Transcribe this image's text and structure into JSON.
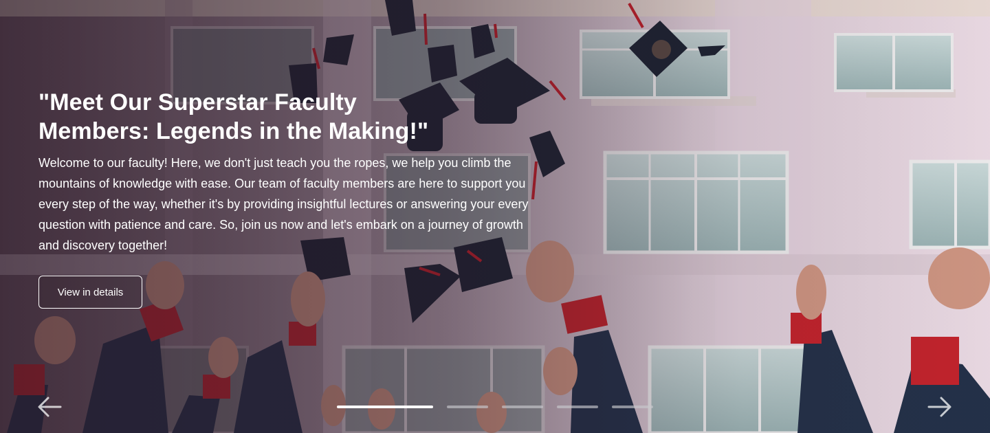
{
  "hero": {
    "title": "\"Meet Our Superstar Faculty Members: Legends in the Making!\"",
    "description": "Welcome to our faculty! Here, we don't just teach you the ropes, we help you climb the mountains of knowledge with ease. Our team of faculty members are here to support you every step of the way, whether it's by providing insightful lectures or answering your every question with patience and care. So, join us now and let's embark on a journey of growth and discovery together!",
    "cta_label": "View in details",
    "background": "graduation caps thrown in the air in front of a pink building"
  },
  "carousel": {
    "slide_count": 5,
    "active_slide": 1,
    "prev_icon": "arrow-left-icon",
    "next_icon": "arrow-right-icon"
  },
  "colors": {
    "text": "#ffffff",
    "overlay": "#28162680",
    "dot_active": "#ffffff",
    "dot_inactive": "#c8c8cd"
  }
}
